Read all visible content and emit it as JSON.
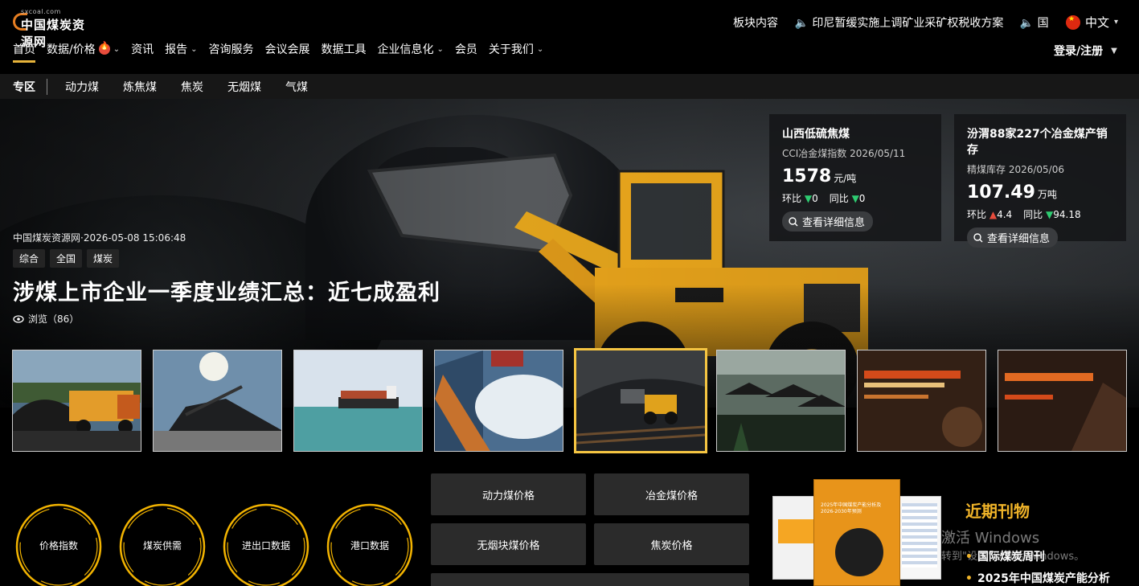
{
  "header": {
    "logo_domain": "sxcoal.com",
    "logo_name": "中国煤炭资源网",
    "ticker": [
      "板块内容",
      "🔈 印尼暂缓实施上调矿业采矿权税收方案",
      "🔈 国"
    ],
    "language": "中文",
    "login": "登录/注册"
  },
  "nav": {
    "items": [
      "首页",
      "数据/价格",
      "资讯",
      "报告",
      "咨询服务",
      "会议会展",
      "数据工具",
      "企业信息化",
      "会员",
      "关于我们"
    ]
  },
  "subnav": {
    "zone": "专区",
    "items": [
      "动力煤",
      "炼焦煤",
      "焦炭",
      "无烟煤",
      "气煤"
    ]
  },
  "hero": {
    "meta": "中国煤炭资源网·2026-05-08 15:06:48",
    "tags": [
      "综合",
      "全国",
      "煤炭"
    ],
    "headline": "涉煤上市企业一季度业绩汇总：近七成盈利",
    "views": "浏览（86）"
  },
  "cards": [
    {
      "title": "山西低硫焦煤",
      "sub": "CCI冶金煤指数 2026/05/11",
      "value": "1578",
      "unit": "元/吨",
      "mom_label": "环比",
      "mom": "0",
      "yoy_label": "同比",
      "yoy": "0",
      "button": "查看详细信息"
    },
    {
      "title": "汾渭88家227个冶金煤产销存",
      "sub": "精煤库存 2026/05/06",
      "value": "107.49",
      "unit": "万吨",
      "mom_label": "环比",
      "mom": "4.4",
      "yoy_label": "同比",
      "yoy": "94.18",
      "button": "查看详细信息"
    }
  ],
  "circles": [
    "价格指数",
    "煤炭供需",
    "进出口数据",
    "港口数据"
  ],
  "price_buttons": [
    "动力煤价格",
    "冶金煤价格",
    "无烟块煤价格",
    "焦炭价格"
  ],
  "journals": {
    "title": "近期刊物",
    "items": [
      "国际煤炭周刊",
      "2025年中国煤炭产能分析"
    ],
    "cover_title": "2025年中国煤炭产能分析及2026-2030年预测"
  },
  "watermark": {
    "line1": "激活 Windows",
    "line2": "转到\"设置\"以激活 Windows。"
  }
}
